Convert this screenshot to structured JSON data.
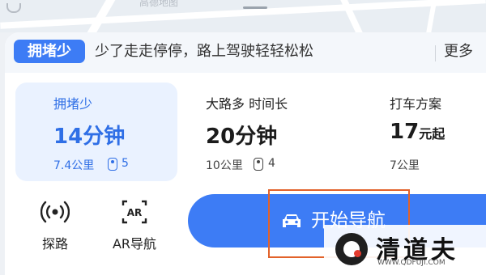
{
  "map": {
    "watermark": "高德地图"
  },
  "banner": {
    "badge": "拥堵少",
    "tip": "少了走走停停，路上驾驶轻轻松松",
    "more": "更多"
  },
  "options": [
    {
      "label": "拥堵少",
      "time_value": "14",
      "time_unit": "分钟",
      "distance": "7.4公里",
      "lights": "5",
      "selected": true
    },
    {
      "label": "大路多 时间长",
      "time_value": "20",
      "time_unit": "分钟",
      "distance": "10公里",
      "lights": "4",
      "selected": false
    },
    {
      "label": "打车方案",
      "price_value": "17",
      "price_unit": "元起",
      "distance": "7公里",
      "selected": false
    }
  ],
  "tools": [
    {
      "label": "探路",
      "icon": "radar-icon"
    },
    {
      "label": "AR导航",
      "icon": "ar-icon"
    }
  ],
  "navigate": {
    "label": "开始导航",
    "icon": "car-icon"
  },
  "watermark_brand": {
    "name": "清道夫",
    "url": "WWW.QDFUJI.COM"
  },
  "colors": {
    "accent": "#3d7cf5",
    "selected_bg": "#eaf2ff",
    "highlight_box": "#e2622a"
  }
}
